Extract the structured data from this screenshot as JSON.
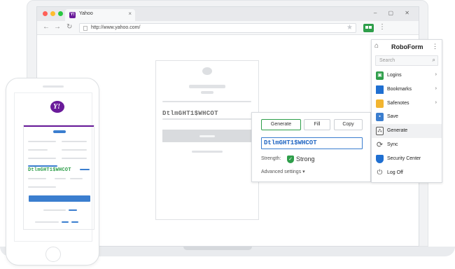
{
  "browser": {
    "tab_title": "Yahoo",
    "tab_favicon": "Y!",
    "tab_close": "×",
    "url": "http://www.yahoo.com/",
    "window_controls": "– ▢ ✕",
    "colors": {
      "traffic_red": "#ff5f57",
      "traffic_yellow": "#febc2e",
      "traffic_green": "#28c840"
    }
  },
  "page": {
    "generated_password": "DtlmGHT1$WHCOT"
  },
  "generator": {
    "generate_label": "Generate",
    "fill_label": "Fill",
    "copy_label": "Copy",
    "password": "DtlmGHT1$WHCOT",
    "strength_label": "Strength:",
    "strength_value": "Strong",
    "advanced_label": "Advanced settings ▾"
  },
  "roboform": {
    "title": "RoboForm",
    "search_placeholder": "Search",
    "items": [
      {
        "label": "Logins",
        "icon": "lock-icon",
        "color": "#2e9e4a",
        "chevron": true
      },
      {
        "label": "Bookmarks",
        "icon": "bookmark-icon",
        "color": "#1f6fd1",
        "chevron": true
      },
      {
        "label": "Safenotes",
        "icon": "note-icon",
        "color": "#f2b531",
        "chevron": true
      },
      {
        "label": "Save",
        "icon": "floppy-icon",
        "color": "#3b7ecf",
        "chevron": false
      },
      {
        "label": "Generate",
        "icon": "generate-icon",
        "color": "#555555",
        "chevron": false
      },
      {
        "label": "Sync",
        "icon": "sync-icon",
        "color": "#555555",
        "chevron": false
      },
      {
        "label": "Security Center",
        "icon": "shield-icon",
        "color": "#1f6fd1",
        "chevron": false
      },
      {
        "label": "Log Off",
        "icon": "power-icon",
        "color": "#555555",
        "chevron": false
      }
    ]
  },
  "phone": {
    "logo": "Y!",
    "password": "DtlmGHT1$WHCOT"
  }
}
